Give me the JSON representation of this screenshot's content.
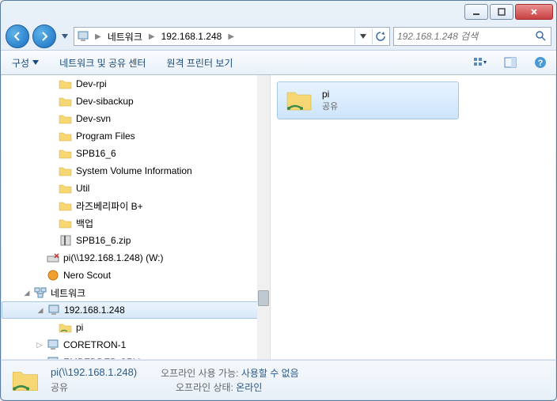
{
  "breadcrumb": {
    "root": "네트워크",
    "host": "192.168.1.248"
  },
  "search": {
    "placeholder": "192.168.1.248 검색"
  },
  "toolbar": {
    "organize": "구성",
    "network_center": "네트워크 및 공유 센터",
    "remote_printers": "원격 프린터 보기"
  },
  "tree": {
    "items": [
      {
        "indent": 3,
        "icon": "folder",
        "label": "Dev-rpi"
      },
      {
        "indent": 3,
        "icon": "folder",
        "label": "Dev-sibackup"
      },
      {
        "indent": 3,
        "icon": "folder",
        "label": "Dev-svn"
      },
      {
        "indent": 3,
        "icon": "folder",
        "label": "Program Files"
      },
      {
        "indent": 3,
        "icon": "folder",
        "label": "SPB16_6"
      },
      {
        "indent": 3,
        "icon": "folder",
        "label": "System Volume Information"
      },
      {
        "indent": 3,
        "icon": "folder",
        "label": "Util"
      },
      {
        "indent": 3,
        "icon": "folder",
        "label": "라즈베리파이 B+"
      },
      {
        "indent": 3,
        "icon": "folder",
        "label": "백업"
      },
      {
        "indent": 3,
        "icon": "zip",
        "label": "SPB16_6.zip"
      },
      {
        "indent": 2,
        "icon": "drive-x",
        "label": "pi(\\\\192.168.1.248) (W:)"
      },
      {
        "indent": 2,
        "icon": "globe",
        "label": "Nero Scout"
      },
      {
        "indent": 1,
        "icon": "network",
        "label": "네트워크",
        "expand": "open"
      },
      {
        "indent": 2,
        "icon": "computer",
        "label": "192.168.1.248",
        "selected": true,
        "expand": "open"
      },
      {
        "indent": 3,
        "icon": "share",
        "label": "pi"
      },
      {
        "indent": 2,
        "icon": "computer",
        "label": "CORETRON-1",
        "expand": "closed"
      },
      {
        "indent": 2,
        "icon": "computer",
        "label": "EMBEDDED-SRV",
        "expand": "closed"
      }
    ]
  },
  "main": {
    "item_name": "pi",
    "item_sub": "공유"
  },
  "details": {
    "title": "pi(\\\\192.168.1.248)",
    "subtitle": "공유",
    "offline_label": "오프라인 사용 가능:",
    "offline_value": "사용할 수 없음",
    "status_label": "오프라인 상태:",
    "status_value": "온라인"
  }
}
